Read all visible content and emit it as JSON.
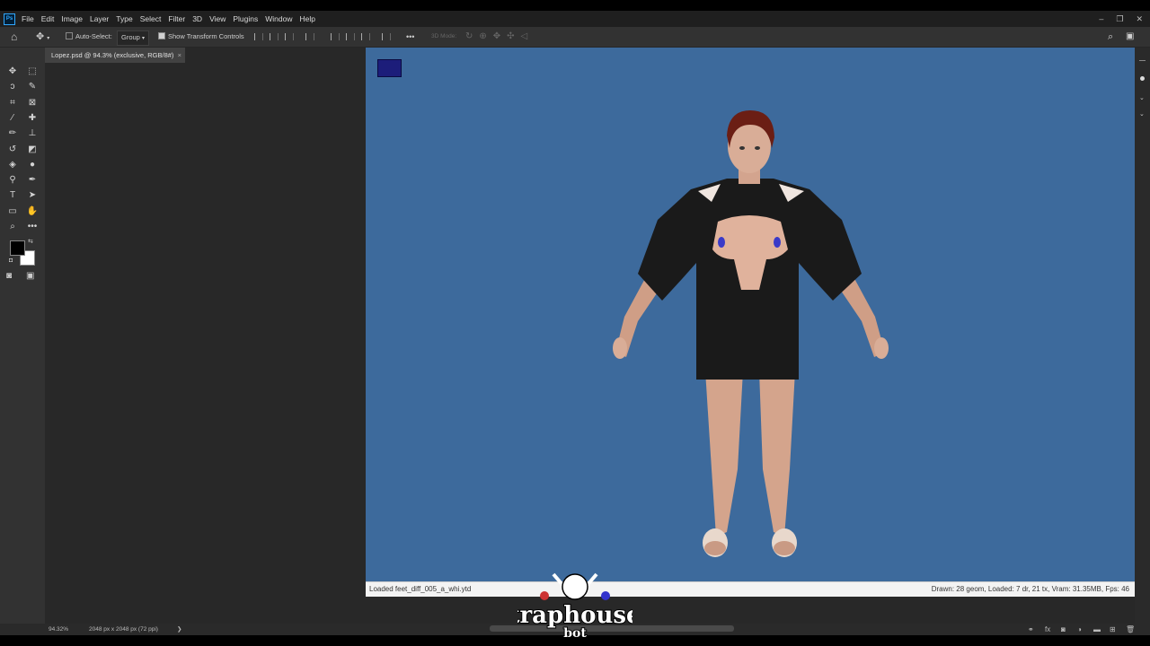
{
  "app": {
    "logo": "Ps"
  },
  "menu": [
    "File",
    "Edit",
    "Image",
    "Layer",
    "Type",
    "Select",
    "Filter",
    "3D",
    "View",
    "Plugins",
    "Window",
    "Help"
  ],
  "window_controls": {
    "minimize": "–",
    "restore": "❐",
    "close": "✕"
  },
  "options": {
    "auto_select_label": "Auto-Select:",
    "auto_select_checked": false,
    "group_value": "Group",
    "show_transform_label": "Show Transform Controls",
    "show_transform_checked": true,
    "more": "•••",
    "mode_3d": "3D Mode:"
  },
  "document_tab": {
    "title": "Lopez.psd @ 94.3% (exclusive, RGB/8#)",
    "close": "×"
  },
  "tools": [
    {
      "name": "move-tool-icon",
      "glyph": "✥"
    },
    {
      "name": "marquee-tool-icon",
      "glyph": "⬚"
    },
    {
      "name": "lasso-tool-icon",
      "glyph": "ↄ"
    },
    {
      "name": "quick-select-tool-icon",
      "glyph": "✎"
    },
    {
      "name": "crop-tool-icon",
      "glyph": "⌗"
    },
    {
      "name": "frame-tool-icon",
      "glyph": "⊠"
    },
    {
      "name": "eyedropper-tool-icon",
      "glyph": "⁄"
    },
    {
      "name": "healing-brush-tool-icon",
      "glyph": "✚"
    },
    {
      "name": "brush-tool-icon",
      "glyph": "✏"
    },
    {
      "name": "clone-stamp-tool-icon",
      "glyph": "⊥"
    },
    {
      "name": "history-brush-tool-icon",
      "glyph": "↺"
    },
    {
      "name": "eraser-tool-icon",
      "glyph": "◩"
    },
    {
      "name": "paint-bucket-tool-icon",
      "glyph": "◈"
    },
    {
      "name": "blur-tool-icon",
      "glyph": "●"
    },
    {
      "name": "dodge-tool-icon",
      "glyph": "⚲"
    },
    {
      "name": "pen-tool-icon",
      "glyph": "✒"
    },
    {
      "name": "type-tool-icon",
      "glyph": "T"
    },
    {
      "name": "path-select-tool-icon",
      "glyph": "➤"
    },
    {
      "name": "rectangle-tool-icon",
      "glyph": "▭"
    },
    {
      "name": "hand-tool-icon",
      "glyph": "✋"
    },
    {
      "name": "zoom-tool-icon",
      "glyph": "⌕"
    },
    {
      "name": "more-tools-icon",
      "glyph": "•••"
    }
  ],
  "colors": {
    "foreground": "#000000",
    "background": "#ffffff",
    "scene_bg": "#3d6a9c",
    "swatch": "#1c1d7a"
  },
  "scene": {
    "status_left": "Loaded feet_diff_005_a_whi.ytd",
    "status_right": "Drawn: 28 geom, Loaded: 7 dr, 21 tx, Vram: 31.35MB, Fps: 46"
  },
  "status": {
    "zoom": "94.32%",
    "doc_size": "2048 px x 2048 px (72 ppi)",
    "arrow": "❯"
  },
  "watermark": {
    "line1": "traphouse",
    "line2": "bot"
  }
}
